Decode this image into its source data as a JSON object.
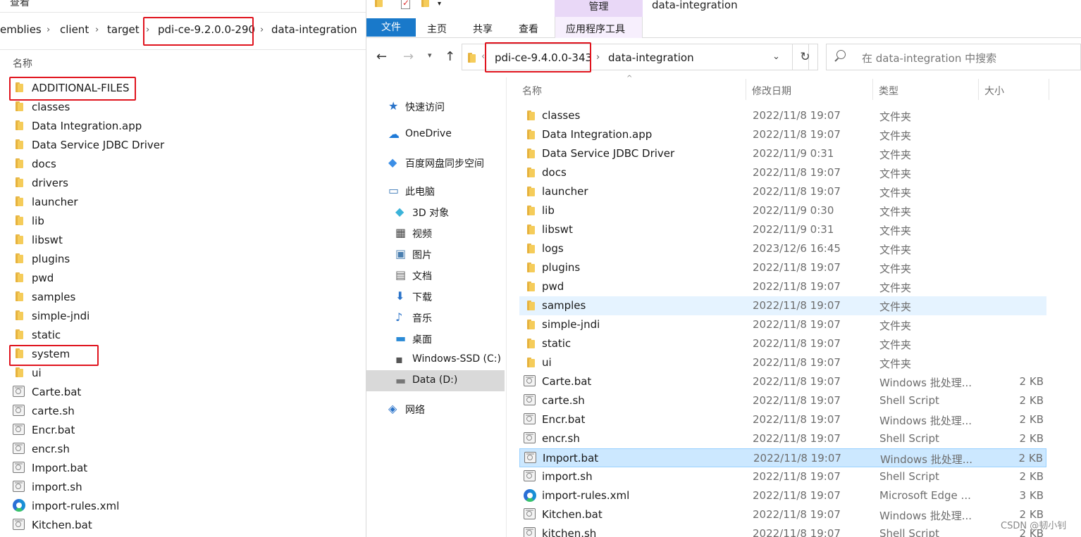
{
  "left": {
    "top_menu": "查看",
    "breadcrumb": [
      "emblies",
      "client",
      "target",
      "pdi-ce-9.2.0.0-290",
      "data-integration"
    ],
    "col_name": "名称",
    "items": [
      {
        "name": "ADDITIONAL-FILES",
        "type": "folder"
      },
      {
        "name": "classes",
        "type": "folder"
      },
      {
        "name": "Data Integration.app",
        "type": "folder"
      },
      {
        "name": "Data Service JDBC Driver",
        "type": "folder"
      },
      {
        "name": "docs",
        "type": "folder"
      },
      {
        "name": "drivers",
        "type": "folder"
      },
      {
        "name": "launcher",
        "type": "folder"
      },
      {
        "name": "lib",
        "type": "folder"
      },
      {
        "name": "libswt",
        "type": "folder"
      },
      {
        "name": "plugins",
        "type": "folder"
      },
      {
        "name": "pwd",
        "type": "folder"
      },
      {
        "name": "samples",
        "type": "folder"
      },
      {
        "name": "simple-jndi",
        "type": "folder"
      },
      {
        "name": "static",
        "type": "folder"
      },
      {
        "name": "system",
        "type": "folder"
      },
      {
        "name": "ui",
        "type": "folder"
      },
      {
        "name": "Carte.bat",
        "type": "file"
      },
      {
        "name": "carte.sh",
        "type": "file"
      },
      {
        "name": "Encr.bat",
        "type": "file"
      },
      {
        "name": "encr.sh",
        "type": "file"
      },
      {
        "name": "Import.bat",
        "type": "file"
      },
      {
        "name": "import.sh",
        "type": "file"
      },
      {
        "name": "import-rules.xml",
        "type": "edge"
      },
      {
        "name": "Kitchen.bat",
        "type": "file"
      }
    ]
  },
  "right": {
    "window_title": "data-integration",
    "ribbon_context_tab": "管理",
    "ribbon_tabs": [
      "文件",
      "主页",
      "共享",
      "查看",
      "应用程序工具"
    ],
    "address": [
      "pdi-ce-9.4.0.0-343",
      "data-integration"
    ],
    "search_placeholder": "在 data-integration 中搜索",
    "nav": [
      {
        "label": "快速访问",
        "icon": "star-icon"
      },
      {
        "label": "OneDrive",
        "icon": "cloud-icon"
      },
      {
        "label": "百度网盘同步空间",
        "icon": "baidu-icon"
      },
      {
        "label": "此电脑",
        "icon": "computer-icon"
      },
      {
        "label": "3D 对象",
        "icon": "cube-icon"
      },
      {
        "label": "视频",
        "icon": "video-icon"
      },
      {
        "label": "图片",
        "icon": "picture-icon"
      },
      {
        "label": "文档",
        "icon": "document-icon"
      },
      {
        "label": "下载",
        "icon": "download-icon"
      },
      {
        "label": "音乐",
        "icon": "music-icon"
      },
      {
        "label": "桌面",
        "icon": "desktop-icon"
      },
      {
        "label": "Windows-SSD (C:)",
        "icon": "drive-c-icon"
      },
      {
        "label": "Data (D:)",
        "icon": "drive-d-icon"
      },
      {
        "label": "网络",
        "icon": "network-icon"
      }
    ],
    "columns": [
      "名称",
      "修改日期",
      "类型",
      "大小"
    ],
    "rows": [
      {
        "name": "classes",
        "date": "2022/11/8 19:07",
        "type": "文件夹",
        "size": "",
        "icon": "folder"
      },
      {
        "name": "Data Integration.app",
        "date": "2022/11/8 19:07",
        "type": "文件夹",
        "size": "",
        "icon": "folder"
      },
      {
        "name": "Data Service JDBC Driver",
        "date": "2022/11/9 0:31",
        "type": "文件夹",
        "size": "",
        "icon": "folder"
      },
      {
        "name": "docs",
        "date": "2022/11/8 19:07",
        "type": "文件夹",
        "size": "",
        "icon": "folder"
      },
      {
        "name": "launcher",
        "date": "2022/11/8 19:07",
        "type": "文件夹",
        "size": "",
        "icon": "folder"
      },
      {
        "name": "lib",
        "date": "2022/11/9 0:30",
        "type": "文件夹",
        "size": "",
        "icon": "folder"
      },
      {
        "name": "libswt",
        "date": "2022/11/9 0:31",
        "type": "文件夹",
        "size": "",
        "icon": "folder"
      },
      {
        "name": "logs",
        "date": "2023/12/6 16:45",
        "type": "文件夹",
        "size": "",
        "icon": "folder"
      },
      {
        "name": "plugins",
        "date": "2022/11/8 19:07",
        "type": "文件夹",
        "size": "",
        "icon": "folder"
      },
      {
        "name": "pwd",
        "date": "2022/11/8 19:07",
        "type": "文件夹",
        "size": "",
        "icon": "folder"
      },
      {
        "name": "samples",
        "date": "2022/11/8 19:07",
        "type": "文件夹",
        "size": "",
        "icon": "folder"
      },
      {
        "name": "simple-jndi",
        "date": "2022/11/8 19:07",
        "type": "文件夹",
        "size": "",
        "icon": "folder"
      },
      {
        "name": "static",
        "date": "2022/11/8 19:07",
        "type": "文件夹",
        "size": "",
        "icon": "folder"
      },
      {
        "name": "ui",
        "date": "2022/11/8 19:07",
        "type": "文件夹",
        "size": "",
        "icon": "folder"
      },
      {
        "name": "Carte.bat",
        "date": "2022/11/8 19:07",
        "type": "Windows 批处理...",
        "size": "2 KB",
        "icon": "file"
      },
      {
        "name": "carte.sh",
        "date": "2022/11/8 19:07",
        "type": "Shell Script",
        "size": "2 KB",
        "icon": "file"
      },
      {
        "name": "Encr.bat",
        "date": "2022/11/8 19:07",
        "type": "Windows 批处理...",
        "size": "2 KB",
        "icon": "file"
      },
      {
        "name": "encr.sh",
        "date": "2022/11/8 19:07",
        "type": "Shell Script",
        "size": "2 KB",
        "icon": "file"
      },
      {
        "name": "Import.bat",
        "date": "2022/11/8 19:07",
        "type": "Windows 批处理...",
        "size": "2 KB",
        "icon": "file"
      },
      {
        "name": "import.sh",
        "date": "2022/11/8 19:07",
        "type": "Shell Script",
        "size": "2 KB",
        "icon": "file"
      },
      {
        "name": "import-rules.xml",
        "date": "2022/11/8 19:07",
        "type": "Microsoft Edge ...",
        "size": "3 KB",
        "icon": "edge"
      },
      {
        "name": "Kitchen.bat",
        "date": "2022/11/8 19:07",
        "type": "Windows 批处理...",
        "size": "2 KB",
        "icon": "file"
      },
      {
        "name": "kitchen.sh",
        "date": "2022/11/8 19:07",
        "type": "Shell Script",
        "size": "2 KB",
        "icon": "file"
      }
    ],
    "hover_row": "samples",
    "selected_row": "Import.bat"
  },
  "watermark": "CSDN @韧小钊",
  "colors": {
    "accent": "#1979ca",
    "selection": "#cce8ff",
    "hover": "#e5f3ff",
    "highlight_box": "#e0141e",
    "context_tab": "#e9d8f7"
  }
}
